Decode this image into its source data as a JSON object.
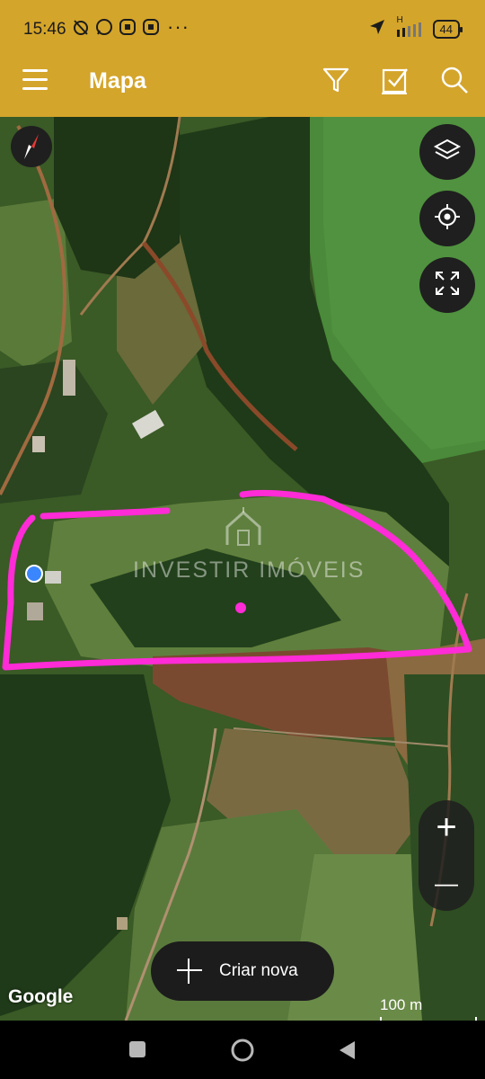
{
  "status_bar": {
    "time": "15:46",
    "dots": "···",
    "network": "H",
    "battery": "44"
  },
  "app_bar": {
    "title": "Mapa",
    "menu_icon": "hamburger-menu-icon",
    "filter_icon": "filter-icon",
    "checklist_icon": "checkbox-icon",
    "search_icon": "search-icon",
    "background_color": "#d4a52b"
  },
  "map": {
    "watermark": "INVESTIR IMÓVEIS",
    "google_logo": "Google",
    "scale_label": "100 m",
    "controls": {
      "layers_icon": "layers-icon",
      "locate_icon": "my-location-icon",
      "fullscreen_icon": "fullscreen-icon",
      "compass_icon": "compass-icon"
    },
    "zoom": {
      "in_label": "+",
      "out_label": "—"
    },
    "annotation_color": "#ff2bd6",
    "location_dot_color": "#3a86ff"
  },
  "create_button": {
    "label": "Criar nova"
  },
  "nav_bar": {
    "recents_icon": "square-icon",
    "home_icon": "circle-icon",
    "back_icon": "triangle-back-icon"
  }
}
